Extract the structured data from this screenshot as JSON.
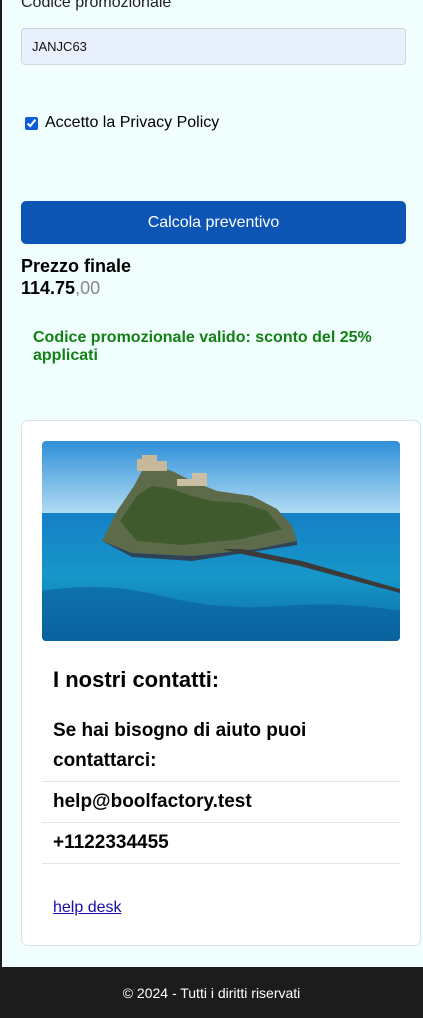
{
  "form": {
    "promo_label": "Codice promozionale",
    "promo_value": "JANJC63",
    "privacy_label": "Accetto la Privacy Policy",
    "privacy_checked": true,
    "calc_button": "Calcola preventivo"
  },
  "result": {
    "price_label": "Prezzo finale",
    "price_int": "114.75",
    "price_dec": ",00",
    "promo_message": "Codice promozionale valido: sconto del 25% applicati"
  },
  "contacts": {
    "image_subject": "island-castle-photo",
    "title": "I nostri contatti:",
    "help_text": "Se hai bisogno di aiuto puoi contattarci:",
    "email": "help@boolfactory.test",
    "phone": "+1122334455",
    "help_link": "help desk"
  },
  "footer": {
    "text": "© 2024 - Tutti i diritti riservati"
  },
  "colors": {
    "page_bg": "#f0fffe",
    "button": "#0d55b5",
    "success": "#138013",
    "footer_bg": "#1c1c1c"
  }
}
